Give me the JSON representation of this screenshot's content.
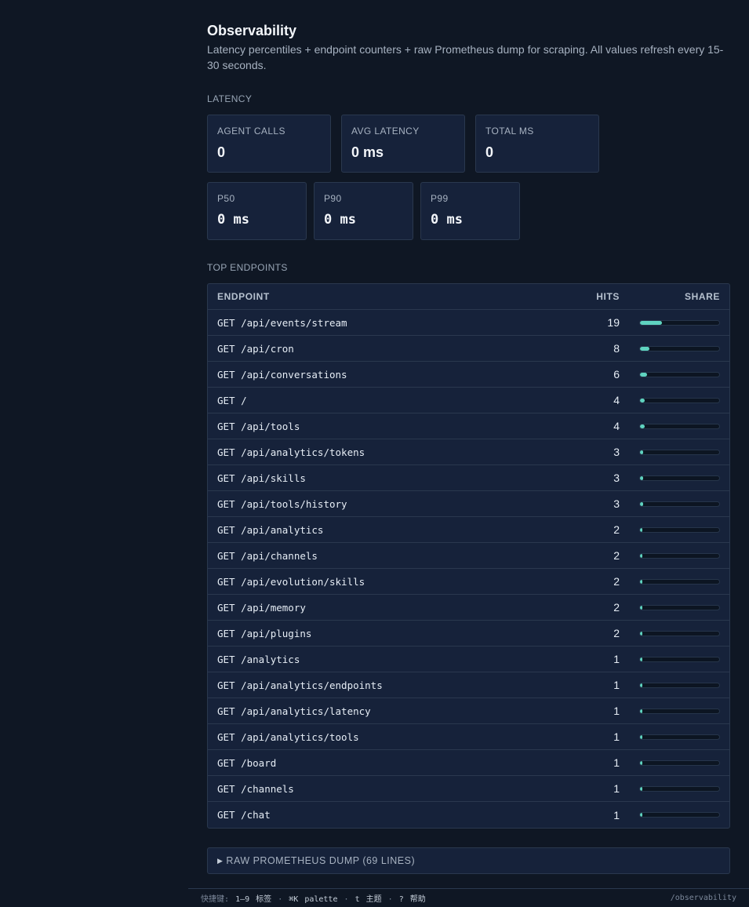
{
  "page": {
    "title": "Observability",
    "description": "Latency percentiles + endpoint counters + raw Prometheus dump for scraping. All values refresh every 15-30 seconds."
  },
  "latency": {
    "section_label": "LATENCY",
    "cards": [
      {
        "label": "AGENT CALLS",
        "value": "0"
      },
      {
        "label": "AVG LATENCY",
        "value": "0 ms"
      },
      {
        "label": "TOTAL MS",
        "value": "0"
      }
    ],
    "percentiles": [
      {
        "label": "P50",
        "value": "0 ms"
      },
      {
        "label": "P90",
        "value": "0 ms"
      },
      {
        "label": "P99",
        "value": "0 ms"
      }
    ]
  },
  "endpoints": {
    "section_label": "TOP ENDPOINTS",
    "columns": {
      "endpoint": "ENDPOINT",
      "hits": "HITS",
      "share": "SHARE"
    },
    "rows": [
      {
        "endpoint": "GET /api/events/stream",
        "hits": "19",
        "share": 0.28
      },
      {
        "endpoint": "GET /api/cron",
        "hits": "8",
        "share": 0.118
      },
      {
        "endpoint": "GET /api/conversations",
        "hits": "6",
        "share": 0.088
      },
      {
        "endpoint": "GET /",
        "hits": "4",
        "share": 0.059
      },
      {
        "endpoint": "GET /api/tools",
        "hits": "4",
        "share": 0.059
      },
      {
        "endpoint": "GET /api/analytics/tokens",
        "hits": "3",
        "share": 0.044
      },
      {
        "endpoint": "GET /api/skills",
        "hits": "3",
        "share": 0.044
      },
      {
        "endpoint": "GET /api/tools/history",
        "hits": "3",
        "share": 0.044
      },
      {
        "endpoint": "GET /api/analytics",
        "hits": "2",
        "share": 0.029
      },
      {
        "endpoint": "GET /api/channels",
        "hits": "2",
        "share": 0.029
      },
      {
        "endpoint": "GET /api/evolution/skills",
        "hits": "2",
        "share": 0.029
      },
      {
        "endpoint": "GET /api/memory",
        "hits": "2",
        "share": 0.029
      },
      {
        "endpoint": "GET /api/plugins",
        "hits": "2",
        "share": 0.029
      },
      {
        "endpoint": "GET /analytics",
        "hits": "1",
        "share": 0.015
      },
      {
        "endpoint": "GET /api/analytics/endpoints",
        "hits": "1",
        "share": 0.015
      },
      {
        "endpoint": "GET /api/analytics/latency",
        "hits": "1",
        "share": 0.015
      },
      {
        "endpoint": "GET /api/analytics/tools",
        "hits": "1",
        "share": 0.015
      },
      {
        "endpoint": "GET /board",
        "hits": "1",
        "share": 0.015
      },
      {
        "endpoint": "GET /channels",
        "hits": "1",
        "share": 0.015
      },
      {
        "endpoint": "GET /chat",
        "hits": "1",
        "share": 0.015
      }
    ]
  },
  "dump": {
    "arrow_icon": "triangle-right-icon",
    "label": "RAW PROMETHEUS DUMP (69 LINES)"
  },
  "footer": {
    "prefix": "快捷键:",
    "k1": "1–9",
    "k1_label": "标签",
    "k2": "⌘K",
    "k2_label": "palette",
    "k3": "t",
    "k3_label": "主题",
    "k4": "?",
    "k4_label": "帮助",
    "sep": "·",
    "path": "/observability"
  },
  "colors": {
    "accent": "#5fd3c0",
    "background": "#0f1724",
    "card": "#16223a",
    "border": "#2a384e"
  }
}
